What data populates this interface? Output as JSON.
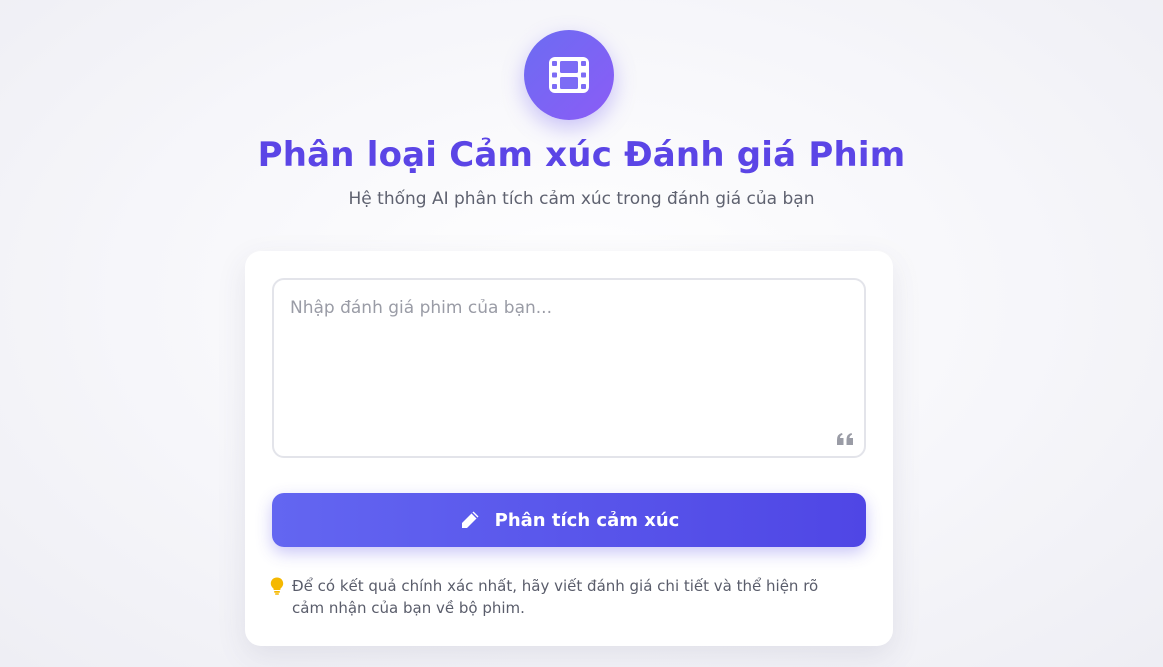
{
  "header": {
    "logo_icon": "film-icon",
    "title": "Phân loại Cảm xúc Đánh giá Phim",
    "subtitle": "Hệ thống AI phân tích cảm xúc trong đánh giá của bạn"
  },
  "form": {
    "review_value": "",
    "review_placeholder": "Nhập đánh giá phim của bạn...",
    "quote_icon": "quote-icon",
    "analyze_button_icon": "pencil-icon",
    "analyze_button_label": "Phân tích cảm xúc",
    "tip_icon": "lightbulb-icon",
    "tip_text": "Để có kết quả chính xác nhất, hãy viết đánh giá chi tiết và thể hiện rõ cảm nhận của bạn về bộ phim."
  },
  "colors": {
    "accent": "#5b45e6",
    "button_start": "#6366f1",
    "button_end": "#4f46e5",
    "tip_icon": "#f5b800"
  }
}
